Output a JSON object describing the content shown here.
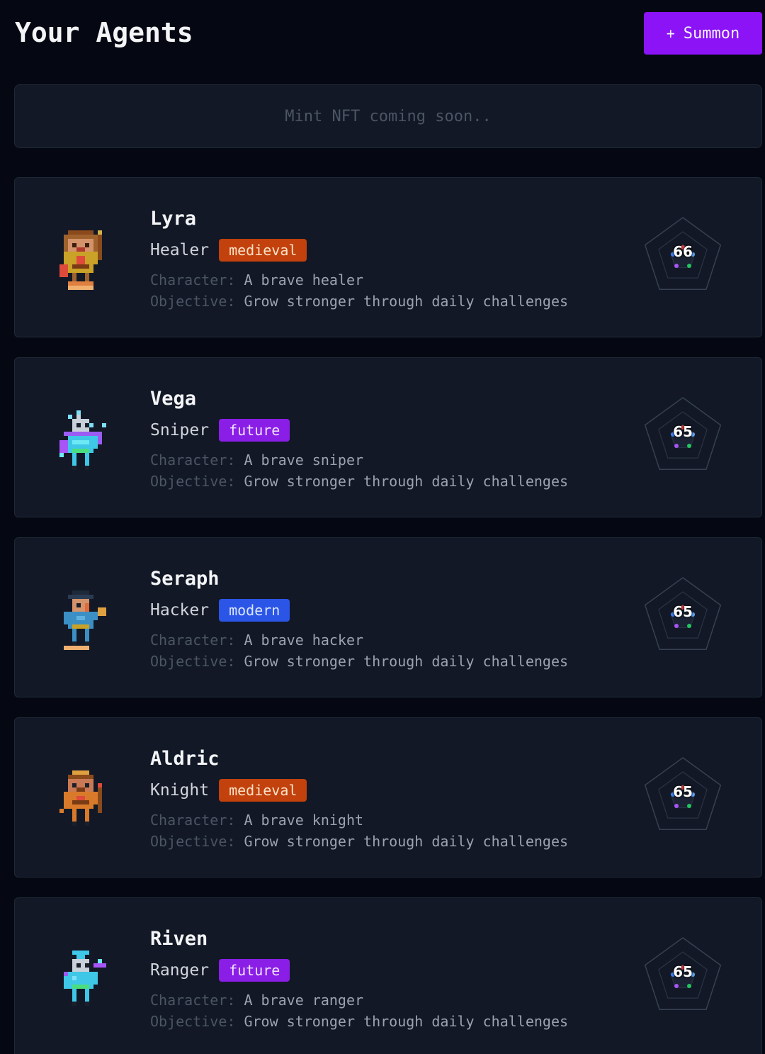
{
  "header": {
    "title": "Your Agents",
    "summon_plus": "+",
    "summon_label": "Summon"
  },
  "mint_banner": {
    "text": "Mint NFT coming soon.."
  },
  "labels": {
    "character_key": "Character:",
    "objective_key": "Objective:"
  },
  "agents": [
    {
      "name": "Lyra",
      "role": "Healer",
      "era": "medieval",
      "character": "A brave healer",
      "objective": "Grow stronger through daily challenges",
      "score": "66",
      "avatar_icon": "healer-pixel-avatar"
    },
    {
      "name": "Vega",
      "role": "Sniper",
      "era": "future",
      "character": "A brave sniper",
      "objective": "Grow stronger through daily challenges",
      "score": "65",
      "avatar_icon": "sniper-pixel-avatar"
    },
    {
      "name": "Seraph",
      "role": "Hacker",
      "era": "modern",
      "character": "A brave hacker",
      "objective": "Grow stronger through daily challenges",
      "score": "65",
      "avatar_icon": "hacker-pixel-avatar"
    },
    {
      "name": "Aldric",
      "role": "Knight",
      "era": "medieval",
      "character": "A brave knight",
      "objective": "Grow stronger through daily challenges",
      "score": "65",
      "avatar_icon": "knight-pixel-avatar"
    },
    {
      "name": "Riven",
      "role": "Ranger",
      "era": "future",
      "character": "A brave ranger",
      "objective": "Grow stronger through daily challenges",
      "score": "65",
      "avatar_icon": "ranger-pixel-avatar"
    }
  ],
  "colors": {
    "background": "#050812",
    "card": "#121826",
    "accent_purple": "#8b13f5",
    "medieval": "#c2410c",
    "future": "#8b1ee6",
    "modern": "#2b55e6"
  }
}
